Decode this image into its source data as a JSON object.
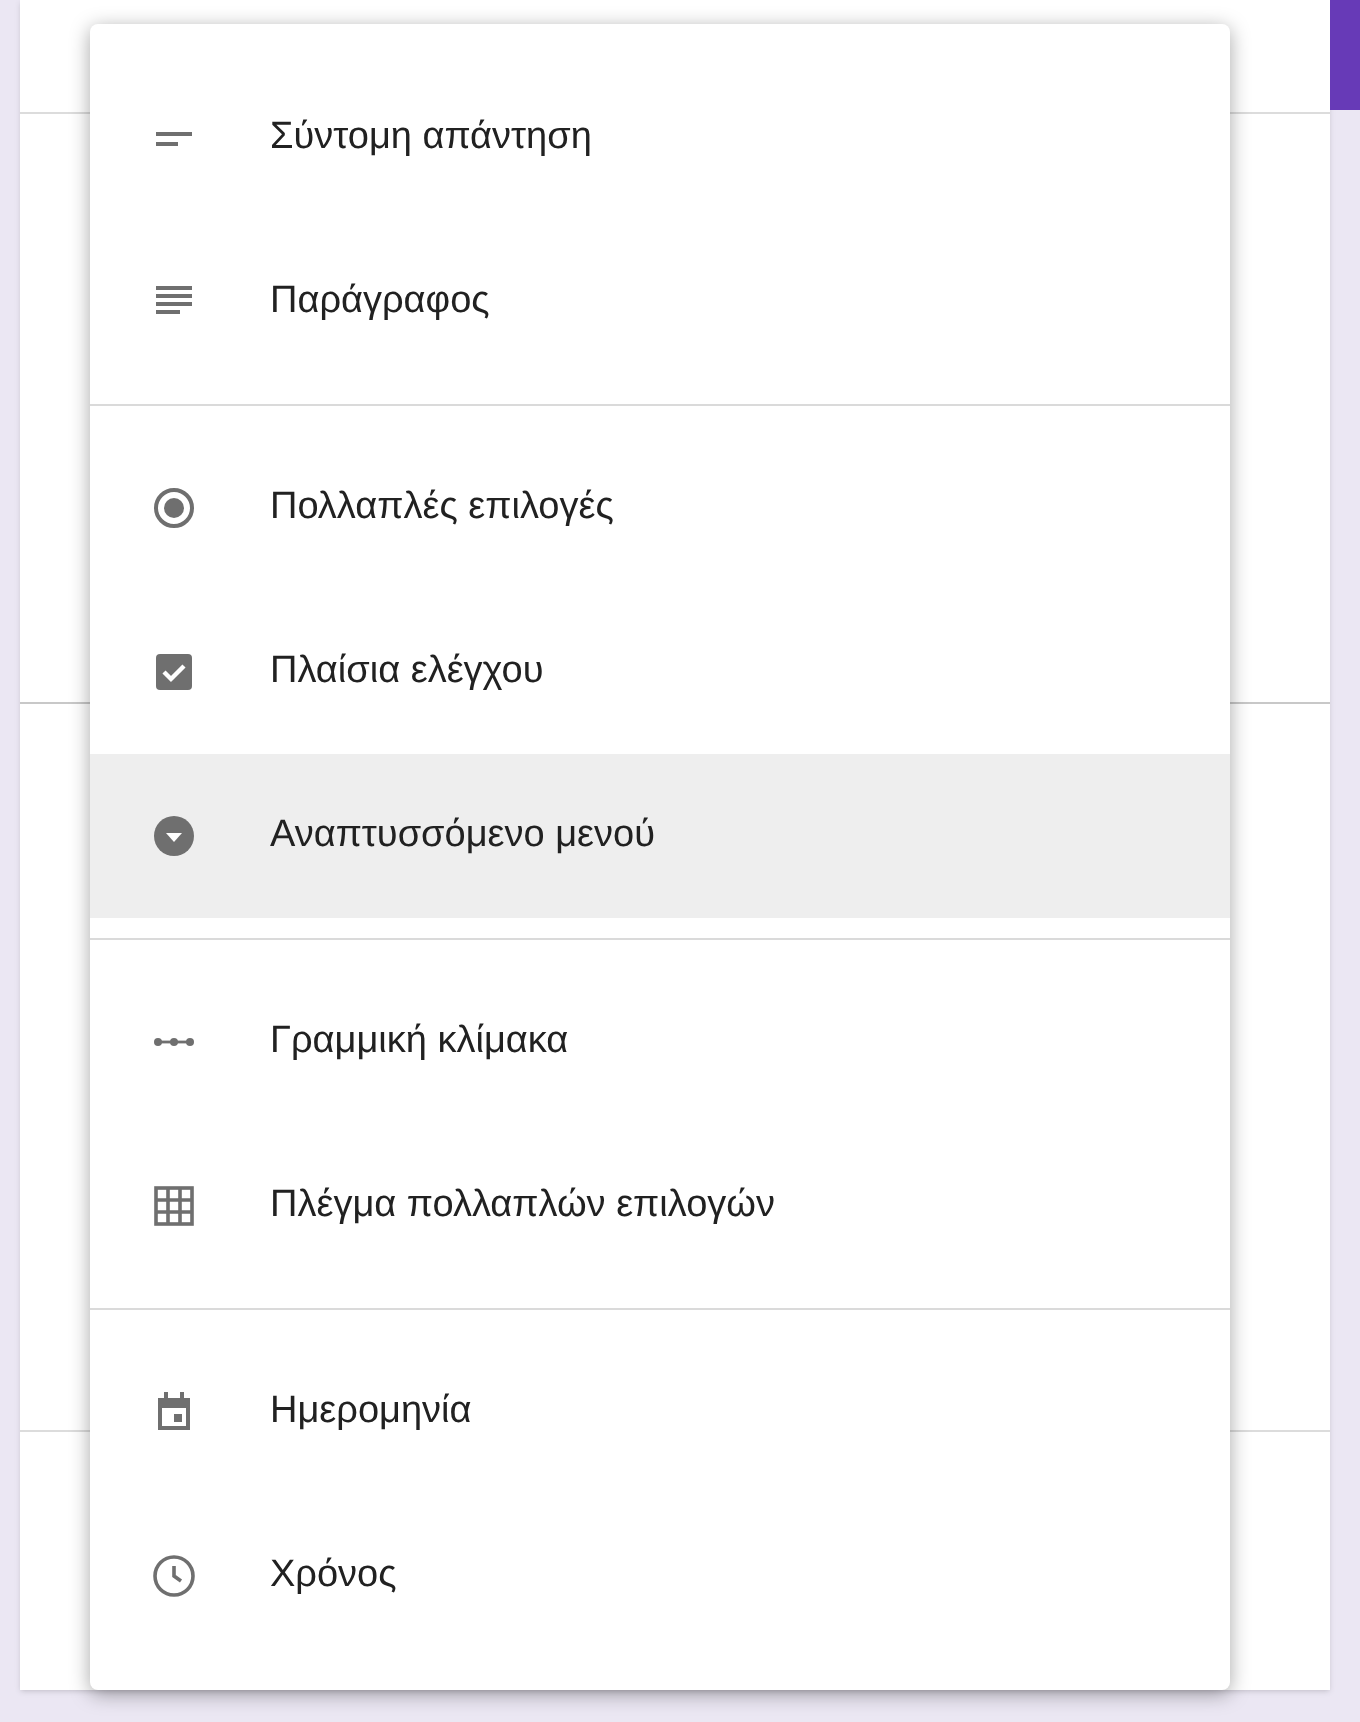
{
  "menu": {
    "groups": [
      {
        "items": [
          {
            "kind": "short",
            "label": "Σύντομη απάντηση",
            "selected": false
          },
          {
            "kind": "paragraph",
            "label": "Παράγραφος",
            "selected": false
          }
        ]
      },
      {
        "items": [
          {
            "kind": "radio",
            "label": "Πολλαπλές επιλογές",
            "selected": false
          },
          {
            "kind": "checkbox",
            "label": "Πλαίσια ελέγχου",
            "selected": false
          },
          {
            "kind": "dropdown",
            "label": "Αναπτυσσόμενο μενού",
            "selected": true
          }
        ]
      },
      {
        "items": [
          {
            "kind": "scale",
            "label": "Γραμμική κλίμακα",
            "selected": false
          },
          {
            "kind": "grid",
            "label": "Πλέγμα πολλαπλών επιλογών",
            "selected": false
          }
        ]
      },
      {
        "items": [
          {
            "kind": "date",
            "label": "Ημερομηνία",
            "selected": false
          },
          {
            "kind": "time",
            "label": "Χρόνος",
            "selected": false
          }
        ]
      }
    ]
  }
}
